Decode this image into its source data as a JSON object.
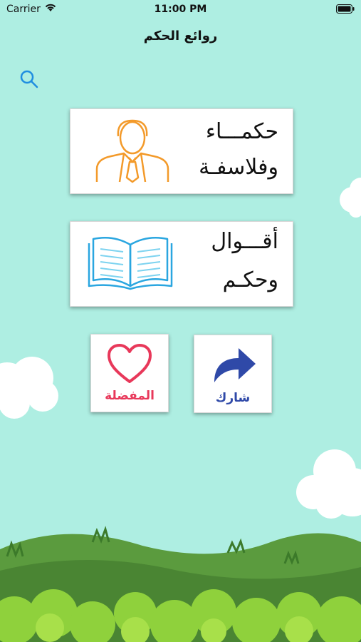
{
  "status_bar": {
    "carrier": "Carrier",
    "time": "11:00 PM"
  },
  "nav": {
    "title": "روائع الحكم"
  },
  "search": {
    "icon": "search-icon"
  },
  "cards": [
    {
      "line1": "حكمـــاء",
      "line2": "وفلاسفـة",
      "icon": "philosopher-person-icon"
    },
    {
      "line1": "أقـــوال",
      "line2": "وحكـم",
      "icon": "open-book-icon"
    }
  ],
  "favorites": {
    "label": "المفضلة",
    "icon": "heart-icon",
    "color": "#e8385a"
  },
  "share": {
    "label": "شارك",
    "icon": "share-arrow-icon",
    "color": "#2f49a8"
  },
  "colors": {
    "sky": "#aeeee2",
    "grass": "#4f8c38",
    "bush": "#8fd13c",
    "person_icon": "#f39a2a",
    "book_icon": "#2aa6e0"
  }
}
